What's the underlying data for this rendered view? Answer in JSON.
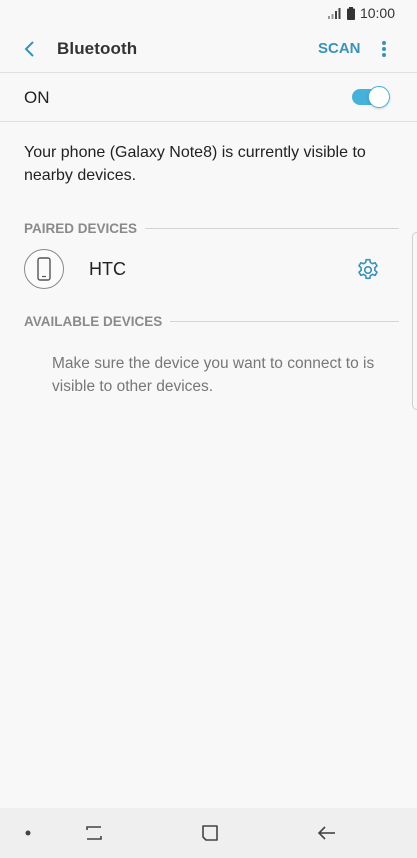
{
  "status_bar": {
    "time": "10:00",
    "icons": [
      "signal-icon",
      "battery-icon"
    ]
  },
  "header": {
    "title": "Bluetooth",
    "scan_label": "SCAN"
  },
  "toggle": {
    "label": "ON",
    "enabled": true
  },
  "visibility_message": "Your phone (Galaxy Note8) is currently visible to nearby devices.",
  "paired_devices": {
    "header": "PAIRED DEVICES",
    "items": [
      {
        "name": "HTC",
        "icon": "phone-icon"
      }
    ]
  },
  "available_devices": {
    "header": "AVAILABLE DEVICES",
    "hint": "Make sure the device you want to connect to is visible to other devices."
  },
  "nav_bar": {
    "buttons": [
      "dot-icon",
      "recent-apps-icon",
      "home-icon",
      "back-icon"
    ]
  },
  "colors": {
    "accent": "#3a93b5",
    "switch_on": "#46b1d9",
    "background": "#f8f8f8"
  }
}
